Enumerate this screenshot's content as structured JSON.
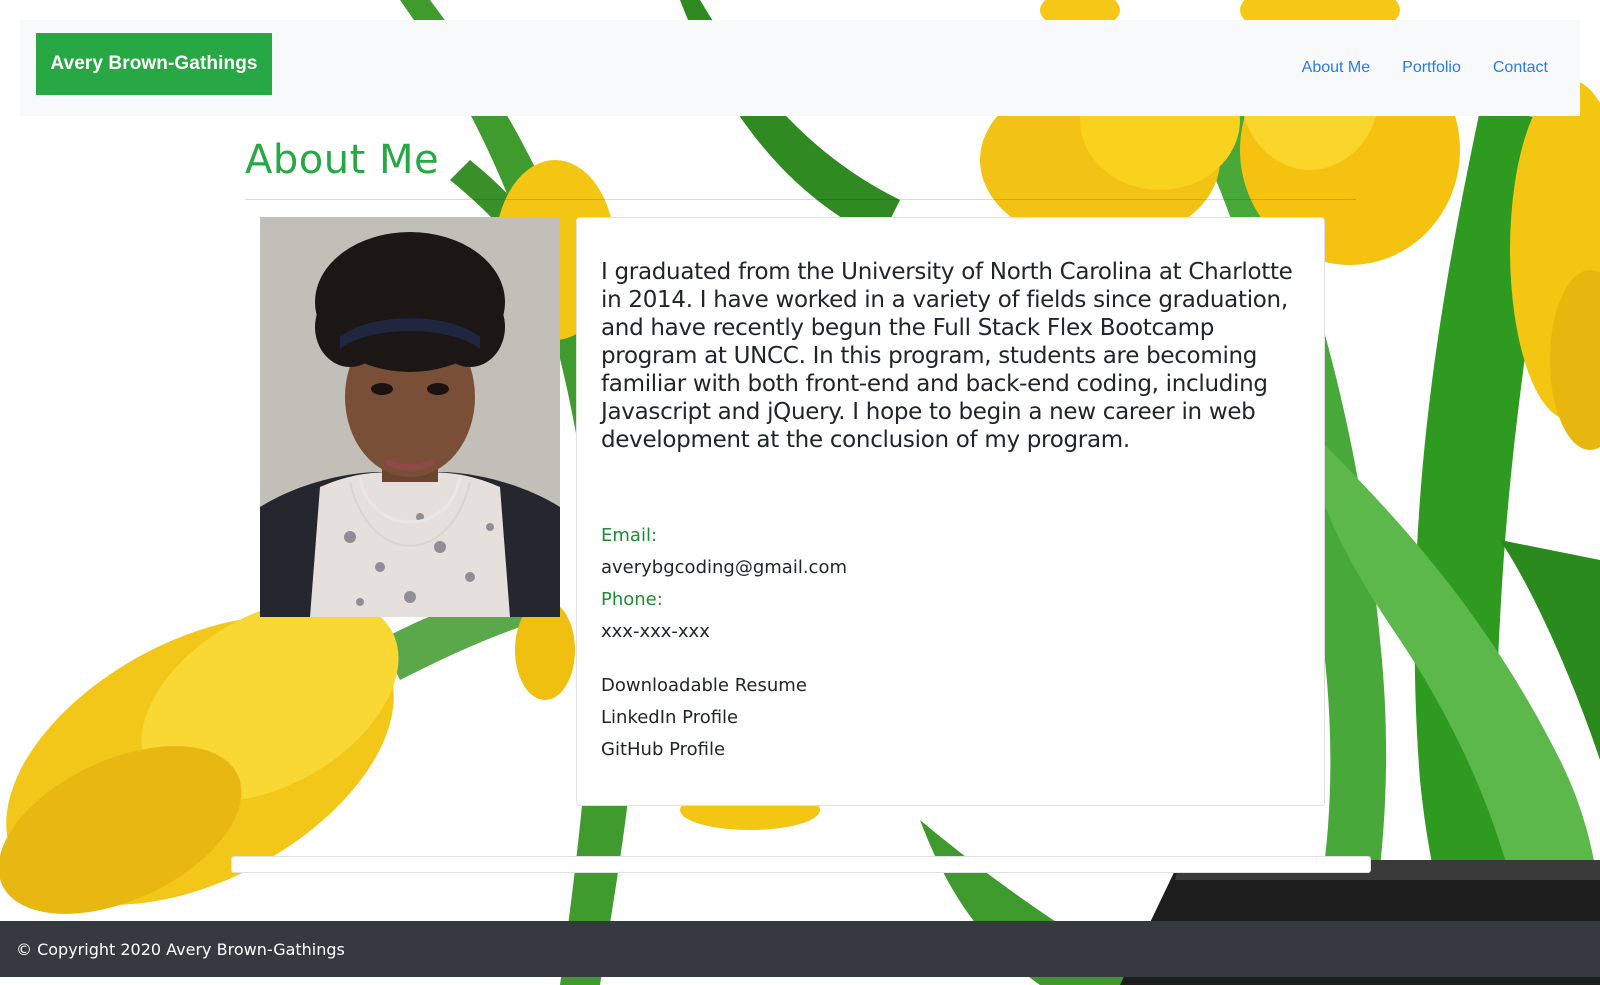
{
  "navbar": {
    "brand": "Avery Brown-Gathings",
    "links": [
      "About Me",
      "Portfolio",
      "Contact"
    ]
  },
  "main": {
    "title": "About Me",
    "bio": "I graduated from the University of North Carolina at Charlotte in 2014. I have worked in a variety of fields since graduation, and have recently begun the Full Stack Flex Bootcamp program at UNCC. In this program, students are becoming familiar with both front-end and back-end coding, including Javascript and jQuery. I hope to begin a new career in web development at the conclusion of my program.",
    "email_label": "Email:",
    "email": "averybgcoding@gmail.com",
    "phone_label": "Phone:",
    "phone": "xxx-xxx-xxx",
    "links": [
      "Downloadable Resume",
      "LinkedIn Profile",
      "GitHub Profile"
    ]
  },
  "footer": {
    "copyright": "© Copyright 2020 Avery Brown-Gathings"
  },
  "colors": {
    "brand_green": "#28a745",
    "link_blue": "#2a7ae2",
    "footer_bg": "#343a40",
    "navbar_bg": "#f8f9fa"
  },
  "icons": {
    "background": "tulips-background-image",
    "photo": "profile-photo"
  }
}
